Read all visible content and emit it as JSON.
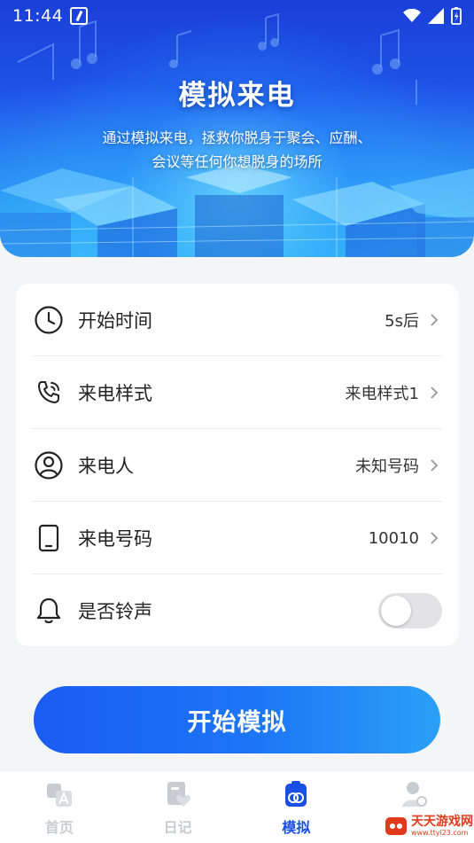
{
  "status_bar": {
    "time": "11:44"
  },
  "banner": {
    "title": "模拟来电",
    "subtitle_line1": "通过模拟来电，拯救你脱身于聚会、应酬、",
    "subtitle_line2": "会议等任何你想脱身的场所"
  },
  "settings": {
    "start_time": {
      "label": "开始时间",
      "value": "5s后"
    },
    "call_style": {
      "label": "来电样式",
      "value": "来电样式1"
    },
    "caller": {
      "label": "来电人",
      "value": "未知号码"
    },
    "caller_number": {
      "label": "来电号码",
      "value": "10010"
    },
    "ringtone": {
      "label": "是否铃声",
      "enabled": false
    }
  },
  "start_button": {
    "label": "开始模拟"
  },
  "tabbar": {
    "home": "首页",
    "diary": "日记",
    "simulate": "模拟",
    "profile": ""
  },
  "watermark": {
    "name": "天天游戏网",
    "url": "www.ttyl23.com"
  },
  "colors": {
    "accent": "#1a4fe6",
    "inactive": "#c9cbd1"
  }
}
